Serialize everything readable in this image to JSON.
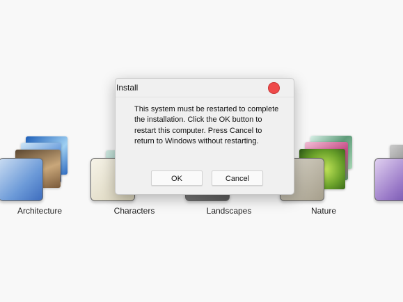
{
  "themes": [
    {
      "label": "Architecture"
    },
    {
      "label": "Characters"
    },
    {
      "label": "Landscapes"
    },
    {
      "label": "Nature"
    }
  ],
  "dialog": {
    "title": "Install",
    "message": "This system must be restarted to complete the installation. Click the OK button to restart this computer. Press Cancel to return to Windows without restarting.",
    "ok_label": "OK",
    "cancel_label": "Cancel",
    "close_color": "#ef4a4a"
  }
}
